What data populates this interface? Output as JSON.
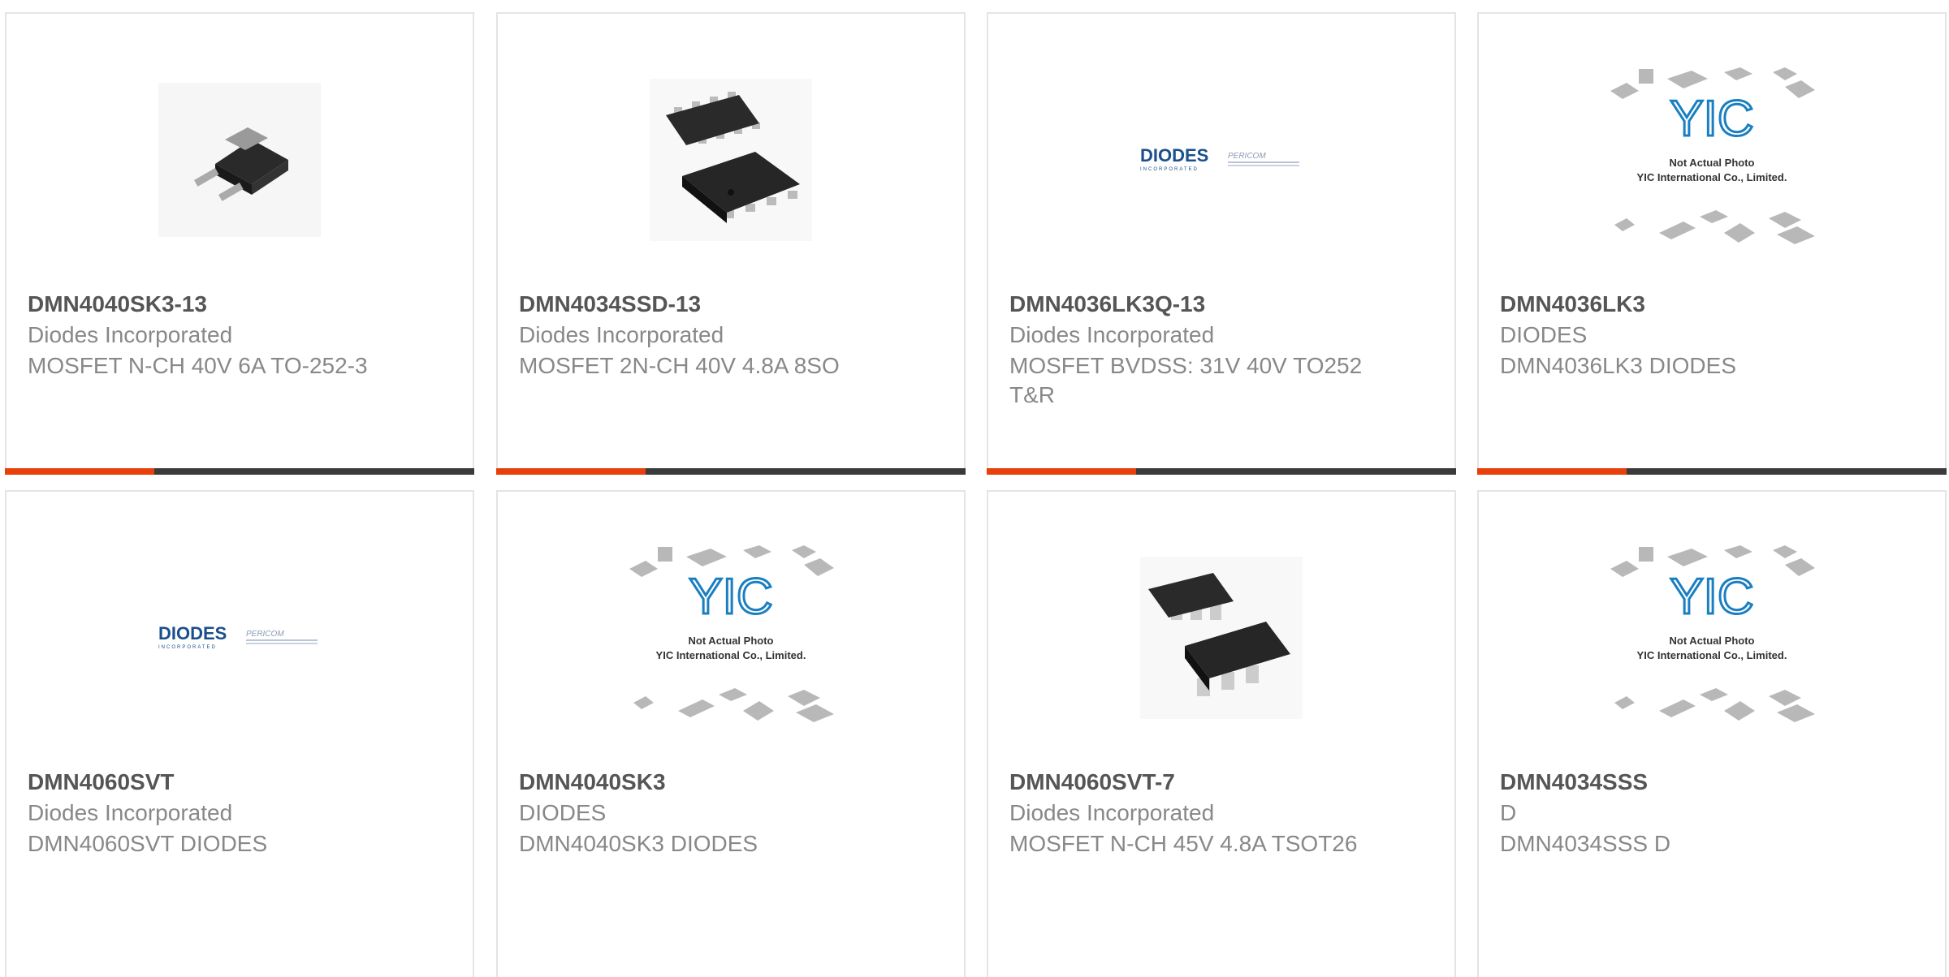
{
  "products": [
    {
      "part": "DMN4040SK3-13",
      "manufacturer": "Diodes Incorporated",
      "description": "MOSFET N-CH 40V 6A TO-252-3",
      "image": "dpak-package"
    },
    {
      "part": "DMN4034SSD-13",
      "manufacturer": "Diodes Incorporated",
      "description": "MOSFET 2N-CH 40V 4.8A 8SO",
      "image": "so8-package"
    },
    {
      "part": "DMN4036LK3Q-13",
      "manufacturer": "Diodes Incorporated",
      "description": "MOSFET BVDSS: 31V 40V TO252 T&R",
      "image": "diodes-logo"
    },
    {
      "part": "DMN4036LK3",
      "manufacturer": "DIODES",
      "description": "DMN4036LK3 DIODES",
      "image": "yic-placeholder"
    },
    {
      "part": "DMN4060SVT",
      "manufacturer": "Diodes Incorporated",
      "description": "DMN4060SVT DIODES",
      "image": "diodes-logo"
    },
    {
      "part": "DMN4040SK3",
      "manufacturer": "DIODES",
      "description": "DMN4040SK3 DIODES",
      "image": "yic-placeholder"
    },
    {
      "part": "DMN4060SVT-7",
      "manufacturer": "Diodes Incorporated",
      "description": "MOSFET N-CH 45V 4.8A TSOT26",
      "image": "tsot26-package"
    },
    {
      "part": "DMN4034SSS",
      "manufacturer": "D",
      "description": "DMN4034SSS D",
      "image": "yic-placeholder"
    }
  ],
  "placeholder": {
    "line1": "Not Actual Photo",
    "line2": "YIC International Co., Limited.",
    "logo": "YIC"
  },
  "logo": {
    "brand": "DIODES",
    "sub": "INCORPORATED",
    "partner": "PERICOM"
  },
  "colors": {
    "accent": "#e8400a",
    "bar": "#3a3a3a",
    "border": "#e4e4e4",
    "title": "#555555",
    "text": "#888888"
  }
}
